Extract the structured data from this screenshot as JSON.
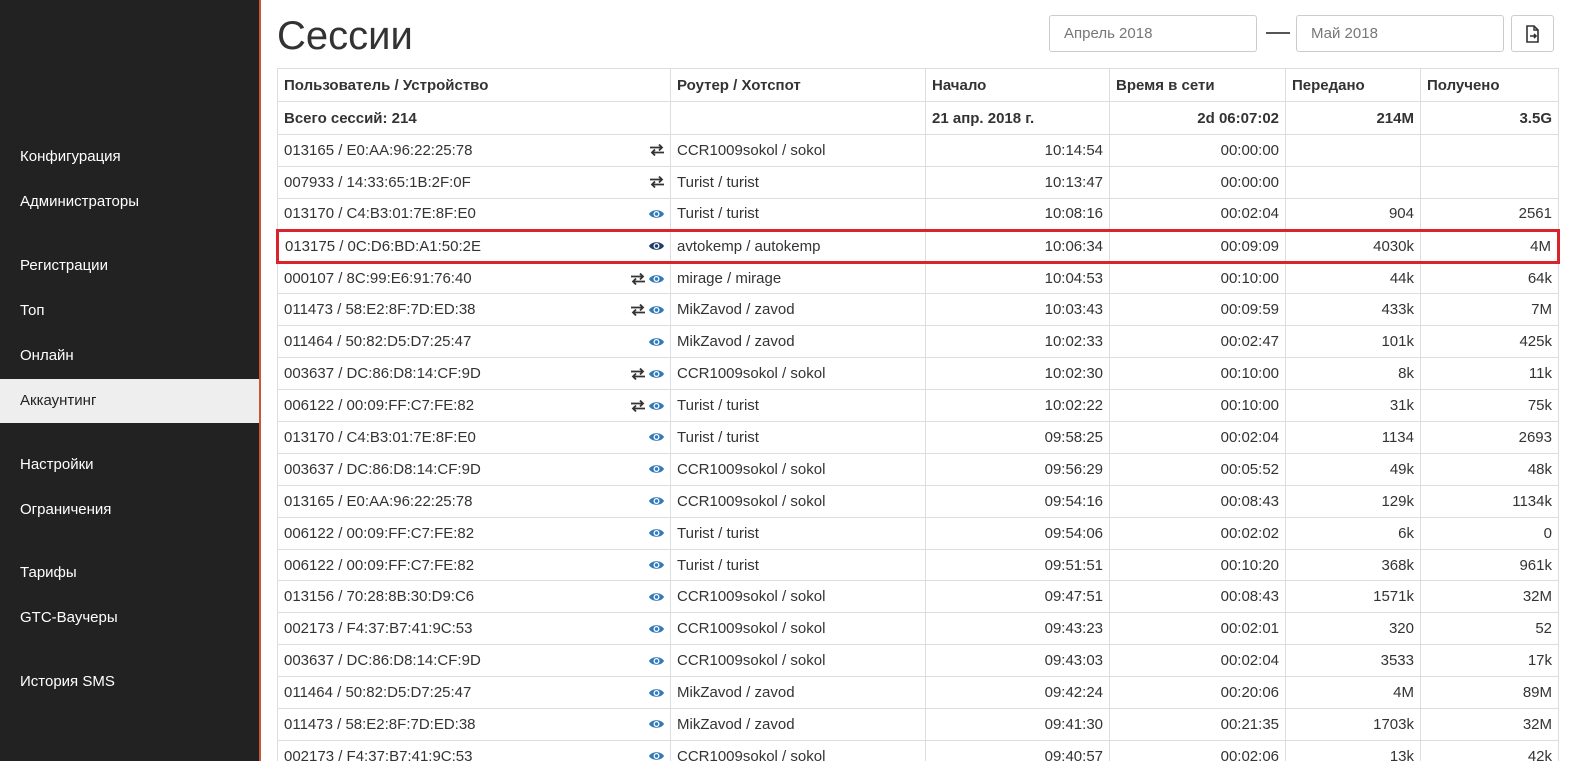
{
  "sidebar": {
    "items": [
      {
        "label": "Конфигурация",
        "active": false
      },
      {
        "label": "Администраторы",
        "active": false
      },
      {
        "label": "Регистрации",
        "active": false
      },
      {
        "label": "Топ",
        "active": false
      },
      {
        "label": "Онлайн",
        "active": false
      },
      {
        "label": "Аккаунтинг",
        "active": true
      },
      {
        "label": "Настройки",
        "active": false
      },
      {
        "label": "Ограничения",
        "active": false
      },
      {
        "label": "Тарифы",
        "active": false
      },
      {
        "label": "GTC-Ваучеры",
        "active": false
      },
      {
        "label": "История SMS",
        "active": false
      }
    ]
  },
  "header": {
    "title": "Сессии",
    "date_from_placeholder": "Апрель 2018",
    "date_to_placeholder": "Май 2018",
    "export_icon": "file-export-icon"
  },
  "table": {
    "columns": [
      "Пользователь / Устройство",
      "Роутер / Хотспот",
      "Начало",
      "Время в сети",
      "Передано",
      "Получено"
    ],
    "totals": {
      "user": "Всего сессий: 214",
      "router": "",
      "start": "21 апр. 2018 г.",
      "online": "2d 06:07:02",
      "sent": "214M",
      "received": "3.5G"
    },
    "rows": [
      {
        "user": "013165 / E0:AA:96:22:25:78",
        "icons": [
          "transfer-icon"
        ],
        "router": "CCR1009sokol / sokol",
        "start": "10:14:54",
        "online": "00:00:00",
        "sent": "",
        "received": ""
      },
      {
        "user": "007933 / 14:33:65:1B:2F:0F",
        "icons": [
          "transfer-icon"
        ],
        "router": "Turist / turist",
        "start": "10:13:47",
        "online": "00:00:00",
        "sent": "",
        "received": ""
      },
      {
        "user": "013170 / C4:B3:01:7E:8F:E0",
        "icons": [
          "eye-icon"
        ],
        "router": "Turist / turist",
        "start": "10:08:16",
        "online": "00:02:04",
        "sent": "904",
        "received": "2561"
      },
      {
        "user": "013175 / 0C:D6:BD:A1:50:2E",
        "icons": [
          "eye-icon-dark"
        ],
        "router": "avtokemp / autokemp",
        "start": "10:06:34",
        "online": "00:09:09",
        "sent": "4030k",
        "received": "4M",
        "highlight": true
      },
      {
        "user": "000107 / 8C:99:E6:91:76:40",
        "icons": [
          "transfer-icon",
          "eye-icon"
        ],
        "router": "mirage / mirage",
        "start": "10:04:53",
        "online": "00:10:00",
        "sent": "44k",
        "received": "64k"
      },
      {
        "user": "011473 / 58:E2:8F:7D:ED:38",
        "icons": [
          "transfer-icon",
          "eye-icon"
        ],
        "router": "MikZavod / zavod",
        "start": "10:03:43",
        "online": "00:09:59",
        "sent": "433k",
        "received": "7M"
      },
      {
        "user": "011464 / 50:82:D5:D7:25:47",
        "icons": [
          "eye-icon"
        ],
        "router": "MikZavod / zavod",
        "start": "10:02:33",
        "online": "00:02:47",
        "sent": "101k",
        "received": "425k"
      },
      {
        "user": "003637 / DC:86:D8:14:CF:9D",
        "icons": [
          "transfer-icon",
          "eye-icon"
        ],
        "router": "CCR1009sokol / sokol",
        "start": "10:02:30",
        "online": "00:10:00",
        "sent": "8k",
        "received": "11k"
      },
      {
        "user": "006122 / 00:09:FF:C7:FE:82",
        "icons": [
          "transfer-icon",
          "eye-icon"
        ],
        "router": "Turist / turist",
        "start": "10:02:22",
        "online": "00:10:00",
        "sent": "31k",
        "received": "75k"
      },
      {
        "user": "013170 / C4:B3:01:7E:8F:E0",
        "icons": [
          "eye-icon"
        ],
        "router": "Turist / turist",
        "start": "09:58:25",
        "online": "00:02:04",
        "sent": "1134",
        "received": "2693"
      },
      {
        "user": "003637 / DC:86:D8:14:CF:9D",
        "icons": [
          "eye-icon"
        ],
        "router": "CCR1009sokol / sokol",
        "start": "09:56:29",
        "online": "00:05:52",
        "sent": "49k",
        "received": "48k"
      },
      {
        "user": "013165 / E0:AA:96:22:25:78",
        "icons": [
          "eye-icon"
        ],
        "router": "CCR1009sokol / sokol",
        "start": "09:54:16",
        "online": "00:08:43",
        "sent": "129k",
        "received": "1134k"
      },
      {
        "user": "006122 / 00:09:FF:C7:FE:82",
        "icons": [
          "eye-icon"
        ],
        "router": "Turist / turist",
        "start": "09:54:06",
        "online": "00:02:02",
        "sent": "6k",
        "received": "0"
      },
      {
        "user": "006122 / 00:09:FF:C7:FE:82",
        "icons": [
          "eye-icon"
        ],
        "router": "Turist / turist",
        "start": "09:51:51",
        "online": "00:10:20",
        "sent": "368k",
        "received": "961k"
      },
      {
        "user": "013156 / 70:28:8B:30:D9:C6",
        "icons": [
          "eye-icon"
        ],
        "router": "CCR1009sokol / sokol",
        "start": "09:47:51",
        "online": "00:08:43",
        "sent": "1571k",
        "received": "32M"
      },
      {
        "user": "002173 / F4:37:B7:41:9C:53",
        "icons": [
          "eye-icon"
        ],
        "router": "CCR1009sokol / sokol",
        "start": "09:43:23",
        "online": "00:02:01",
        "sent": "320",
        "received": "52"
      },
      {
        "user": "003637 / DC:86:D8:14:CF:9D",
        "icons": [
          "eye-icon"
        ],
        "router": "CCR1009sokol / sokol",
        "start": "09:43:03",
        "online": "00:02:04",
        "sent": "3533",
        "received": "17k"
      },
      {
        "user": "011464 / 50:82:D5:D7:25:47",
        "icons": [
          "eye-icon"
        ],
        "router": "MikZavod / zavod",
        "start": "09:42:24",
        "online": "00:20:06",
        "sent": "4M",
        "received": "89M"
      },
      {
        "user": "011473 / 58:E2:8F:7D:ED:38",
        "icons": [
          "eye-icon"
        ],
        "router": "MikZavod / zavod",
        "start": "09:41:30",
        "online": "00:21:35",
        "sent": "1703k",
        "received": "32M"
      },
      {
        "user": "002173 / F4:37:B7:41:9C:53",
        "icons": [
          "eye-icon"
        ],
        "router": "CCR1009sokol / sokol",
        "start": "09:40:57",
        "online": "00:02:06",
        "sent": "13k",
        "received": "42k"
      }
    ]
  },
  "colors": {
    "sidebar_bg": "#222222",
    "active_bg": "#eeeeee",
    "highlight": "#d9232d",
    "eye_icon": "#337ab7",
    "eye_icon_dark": "#1f3f66"
  }
}
